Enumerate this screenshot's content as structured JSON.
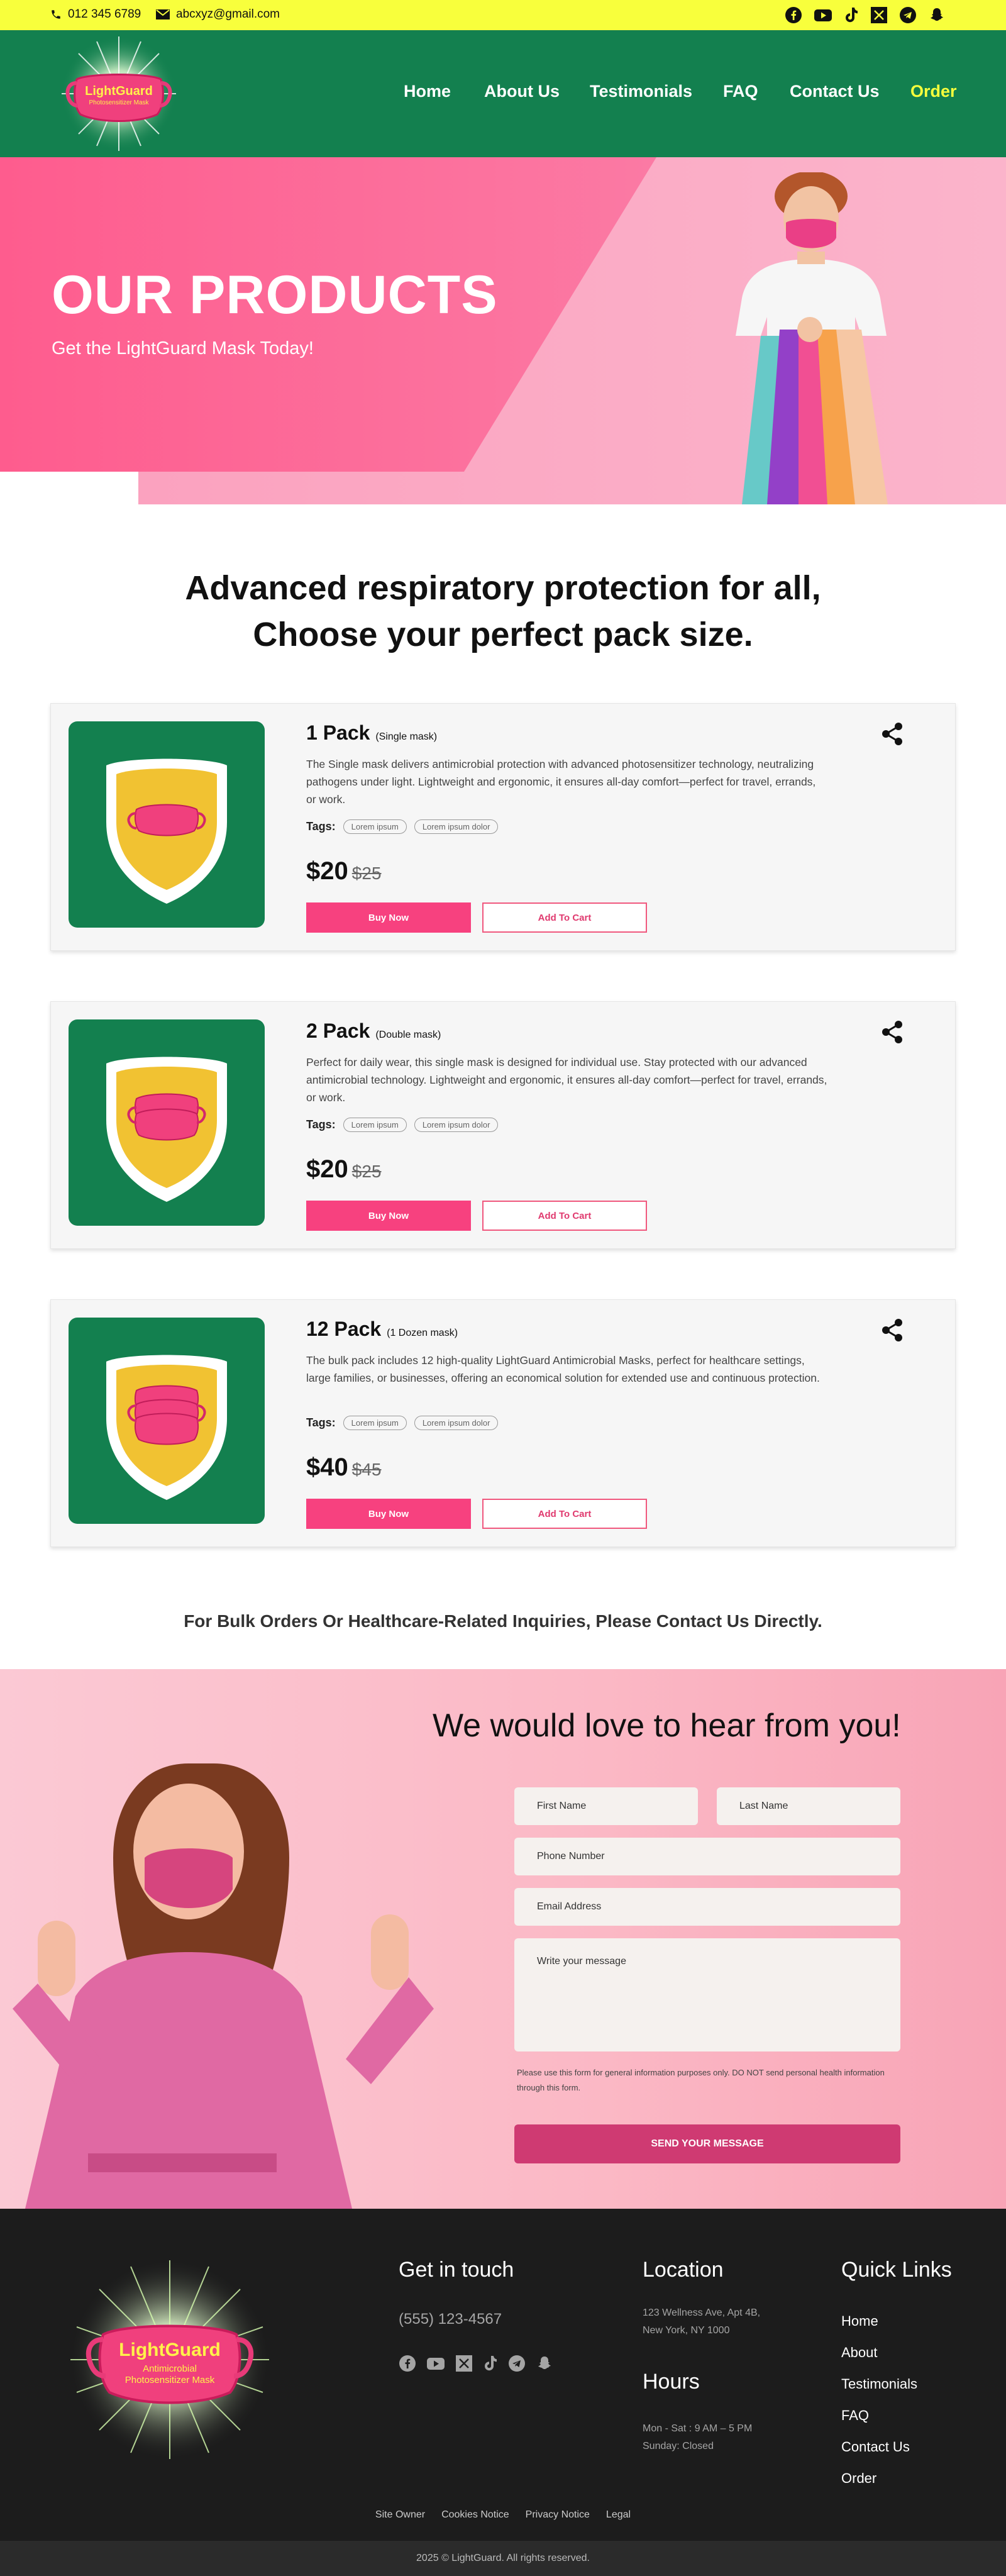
{
  "topbar": {
    "phone": "012 345 6789",
    "email": "abcxyz@gmail.com",
    "social_icons": [
      "facebook-icon",
      "youtube-icon",
      "tiktok-icon",
      "x-icon",
      "telegram-icon",
      "snapchat-icon"
    ]
  },
  "header": {
    "logo_text": "LightGuard",
    "logo_sub": "Photosensitizer Mask",
    "nav": [
      "Home",
      "About Us",
      "Testimonials",
      "FAQ",
      "Contact Us",
      "Order"
    ],
    "active_color": "#f8ff3c"
  },
  "hero": {
    "title": "OUR PRODUCTS",
    "subtitle": "Get the LightGuard Mask Today!"
  },
  "intro": {
    "line1": "Advanced respiratory protection for all,",
    "line2": "Choose your perfect pack size."
  },
  "products": [
    {
      "name": "1 Pack",
      "qualifier": "(Single mask)",
      "desc": "The Single mask delivers antimicrobial protection with advanced photosensitizer technology, neutralizing pathogens under light. Lightweight and ergonomic, it ensures all-day comfort—perfect for travel, errands, or work.",
      "tags_label": "Tags:",
      "tags": [
        "Lorem ipsum",
        "Lorem ipsum dolor"
      ],
      "price": "$20",
      "old_price": "$25",
      "buy_label": "Buy Now",
      "cart_label": "Add To Cart"
    },
    {
      "name": "2 Pack",
      "qualifier": "(Double mask)",
      "desc": "Perfect for daily wear, this single mask is designed for individual use. Stay protected with our advanced antimicrobial technology. Lightweight and ergonomic, it ensures all-day comfort—perfect for travel, errands, or work.",
      "tags_label": "Tags:",
      "tags": [
        "Lorem ipsum",
        "Lorem ipsum dolor"
      ],
      "price": "$20",
      "old_price": "$25",
      "buy_label": "Buy Now",
      "cart_label": "Add To Cart"
    },
    {
      "name": "12 Pack",
      "qualifier": "(1 Dozen mask)",
      "desc": "The  bulk pack includes 12 high-quality LightGuard Antimicrobial Masks, perfect for healthcare settings, large families, or businesses, offering an economical solution for extended use and continuous protection.",
      "tags_label": "Tags:",
      "tags": [
        "Lorem ipsum",
        "Lorem ipsum dolor"
      ],
      "price": "$40",
      "old_price": "$45",
      "buy_label": "Buy Now",
      "cart_label": "Add To Cart"
    }
  ],
  "bulk_note": "For Bulk Orders Or Healthcare-Related Inquiries, Please Contact Us Directly.",
  "contact": {
    "title": "We would love to hear from you!",
    "first_name": "First Name",
    "last_name": "Last Name",
    "phone": "Phone Number",
    "email": "Email Address",
    "message": "Write your message",
    "note": "Please use this form for general information purposes only. DO NOT send personal health information through this form.",
    "send_label": "SEND YOUR MESSAGE"
  },
  "footer": {
    "logo_text": "LightGuard",
    "logo_sub1": "Antimicrobial",
    "logo_sub2": "Photosensitizer Mask",
    "get_in_touch": "Get in touch",
    "phone": "(555) 123-4567",
    "location_title": "Location",
    "address1": "123 Wellness Ave, Apt 4B,",
    "address2": "New York, NY 1000",
    "hours_title": "Hours",
    "hours1": "Mon - Sat : 9 AM – 5 PM",
    "hours2": "Sunday: Closed",
    "quick_links_title": "Quick Links",
    "quick_links": [
      "Home",
      "About",
      "Testimonials",
      "FAQ",
      "Contact Us",
      "Order"
    ],
    "legal_links": [
      "Site Owner",
      "Cookies Notice",
      "Privacy Notice",
      "Legal"
    ],
    "copyright": "2025 © LightGuard.  All rights reserved."
  }
}
